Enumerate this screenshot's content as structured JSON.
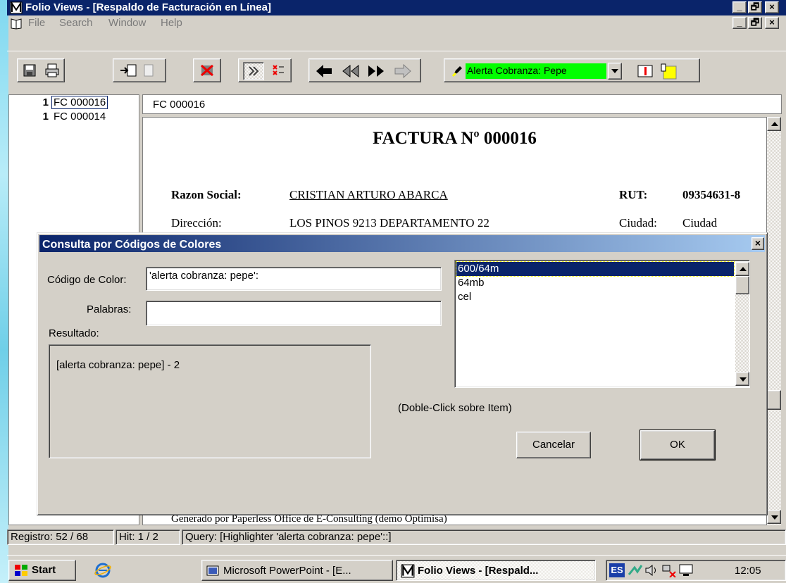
{
  "window": {
    "title": "Folio Views - [Respaldo de Facturación en Línea]",
    "minimize": "_",
    "restore": "🗗",
    "close": "×"
  },
  "menu": {
    "items": [
      "File",
      "Search",
      "Window",
      "Help"
    ]
  },
  "toolbar": {
    "highlighter_value": "Alerta Cobranza: Pepe"
  },
  "results_list": [
    {
      "hits": "1",
      "id": "FC 000016"
    },
    {
      "hits": "1",
      "id": "FC 000014"
    }
  ],
  "document": {
    "header_field": "FC 000016",
    "title": "FACTURA Nº 000016",
    "razon_label": "Razon Social:",
    "razon_value": "CRISTIAN ARTURO ABARCA",
    "rut_label": "RUT:",
    "rut_value": "09354631-8",
    "direccion_label": "Dirección:",
    "direccion_value": "LOS PINOS 9213 DEPARTAMENTO 22",
    "ciudad_label": "Ciudad:",
    "ciudad_value": "Ciudad",
    "footer": "Generado por Paperless Office de E-Consulting (demo Optimisa)"
  },
  "dialog": {
    "title": "Consulta por Códigos de Colores",
    "codigo_label": "Código de Color:",
    "codigo_value": "'alerta cobranza: pepe':",
    "palabras_label": "Palabras:",
    "palabras_value": "",
    "resultado_label": "Resultado:",
    "resultado_value": "[alerta cobranza: pepe] - 2",
    "list_items": [
      "600/64m",
      "64mb",
      "cel"
    ],
    "list_hint": "(Doble-Click sobre Item)",
    "cancel_label": "Cancelar",
    "ok_label": "OK"
  },
  "status": {
    "registro": "Registro: 52 / 68",
    "hit": "Hit: 1 / 2",
    "query": "Query: [Highlighter 'alerta cobranza: pepe'::]"
  },
  "taskbar": {
    "start_label": "Start",
    "tasks": [
      "Microsoft PowerPoint - [E...",
      "Folio Views - [Respald..."
    ],
    "lang": "ES",
    "clock": "12:05"
  },
  "colors": {
    "title_blue": "#0a246a",
    "highlight_green": "#00ff00",
    "selection_blue": "#0a246a"
  }
}
